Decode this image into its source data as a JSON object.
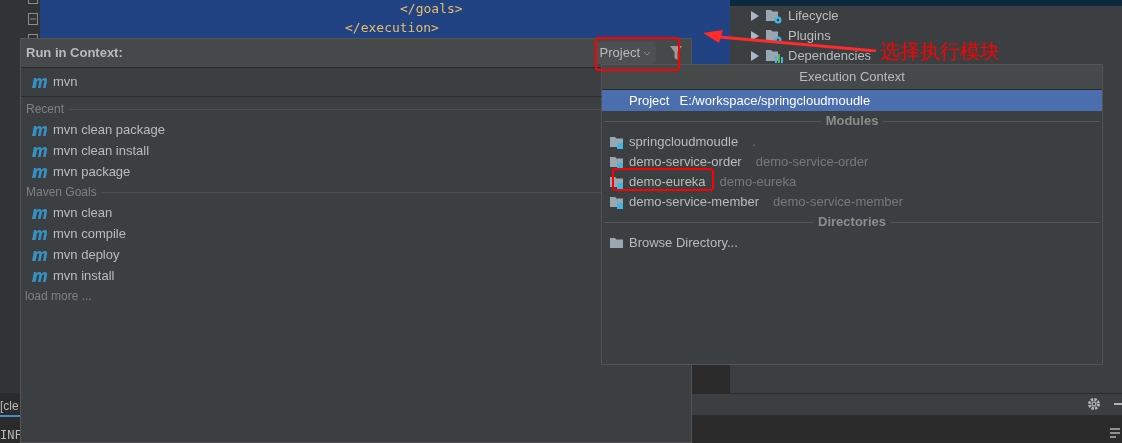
{
  "editor": {
    "code_lines": [
      {
        "text": "</goals>"
      },
      {
        "text": "</execution>"
      }
    ]
  },
  "maven_tree": {
    "items": [
      {
        "label": "Lifecycle",
        "kind": "lifecycle"
      },
      {
        "label": "Plugins",
        "kind": "plugins"
      },
      {
        "label": "Dependencies",
        "kind": "dependencies"
      }
    ]
  },
  "run_popup": {
    "title": "Run in Context:",
    "context_button": "Project",
    "query": "mvn",
    "groups": [
      {
        "title": "Recent",
        "items": [
          "mvn clean package",
          "mvn clean install",
          "mvn package"
        ]
      },
      {
        "title": "Maven Goals",
        "items": [
          "mvn clean",
          "mvn compile",
          "mvn deploy",
          "mvn install"
        ]
      }
    ],
    "load_more": "load more ..."
  },
  "context_menu": {
    "title": "Execution Context",
    "project": {
      "label": "Project",
      "path": "E:/workspace/springcloudmoudle",
      "selected": true
    },
    "sections": [
      {
        "title": "Modules",
        "items": [
          {
            "name": "springcloudmoudle",
            "detail": ".",
            "kind": "module"
          },
          {
            "name": "demo-service-order",
            "detail": "demo-service-order",
            "kind": "module"
          },
          {
            "name": "demo-eureka",
            "detail": "demo-eureka",
            "kind": "module"
          },
          {
            "name": "demo-service-member",
            "detail": "demo-service-member",
            "kind": "module"
          }
        ]
      },
      {
        "title": "Directories",
        "items": [
          {
            "name": "Browse Directory...",
            "kind": "folder"
          }
        ]
      }
    ]
  },
  "console": {
    "lines": [
      "[cle",
      "INF"
    ]
  },
  "annotation": {
    "text": "选择执行模块",
    "color": "#ff0000"
  }
}
